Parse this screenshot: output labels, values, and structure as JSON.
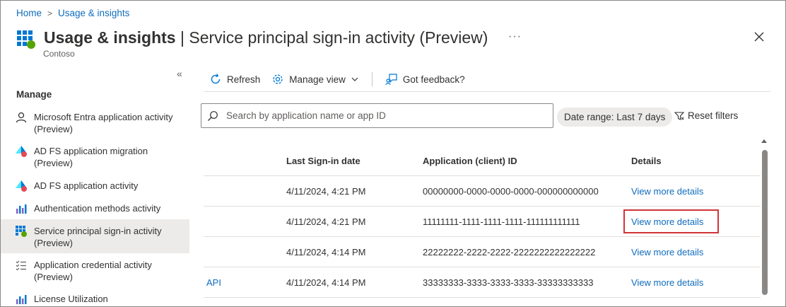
{
  "breadcrumb": {
    "home": "Home",
    "sep": ">",
    "current": "Usage & insights"
  },
  "header": {
    "title_bold": "Usage & insights",
    "title_sep": " | ",
    "title_rest": "Service principal sign-in activity (Preview)",
    "subtitle": "Contoso",
    "more": "···",
    "icon": "grid-app-icon"
  },
  "nav": {
    "collapse": "«",
    "header": "Manage",
    "items": [
      {
        "label": "Microsoft Entra application activity (Preview)",
        "icon": "person-icon"
      },
      {
        "label": "AD FS application migration (Preview)",
        "icon": "adfs-icon"
      },
      {
        "label": "AD FS application activity",
        "icon": "adfs-icon"
      },
      {
        "label": "Authentication methods activity",
        "icon": "bar-chart-icon"
      },
      {
        "label": "Service principal sign-in activity (Preview)",
        "icon": "grid-app-icon",
        "active": true
      },
      {
        "label": "Application credential activity (Preview)",
        "icon": "list-check-icon"
      },
      {
        "label": "License Utilization",
        "icon": "bar-chart-icon"
      }
    ]
  },
  "toolbar": {
    "refresh": "Refresh",
    "manage_view": "Manage view",
    "feedback": "Got feedback?"
  },
  "search": {
    "placeholder": "Search by application name or app ID",
    "value": ""
  },
  "filters": {
    "date_range": "Date range: Last 7 days",
    "reset": "Reset filters"
  },
  "table": {
    "headers": {
      "name": "",
      "date": "Last Sign-in date",
      "id": "Application (client) ID",
      "details": "Details"
    },
    "rows": [
      {
        "name": "",
        "date": "4/11/2024, 4:21 PM",
        "id": "00000000-0000-0000-0000-000000000000",
        "details": "View more details"
      },
      {
        "name": "",
        "date": "4/11/2024, 4:21 PM",
        "id": "11111111-1111-1111-1111-111111111111",
        "details": "View more details",
        "highlighted": true
      },
      {
        "name": "",
        "date": "4/11/2024, 4:14 PM",
        "id": "22222222-2222-2222-2222222222222222",
        "details": "View more details"
      },
      {
        "name": "API",
        "date": "4/11/2024, 4:14 PM",
        "id": "33333333-3333-3333-3333-33333333333",
        "details": "View more details"
      }
    ]
  },
  "colors": {
    "link": "#0f6cbd",
    "highlight": "#d13438",
    "active_nav": "#edebe9"
  }
}
